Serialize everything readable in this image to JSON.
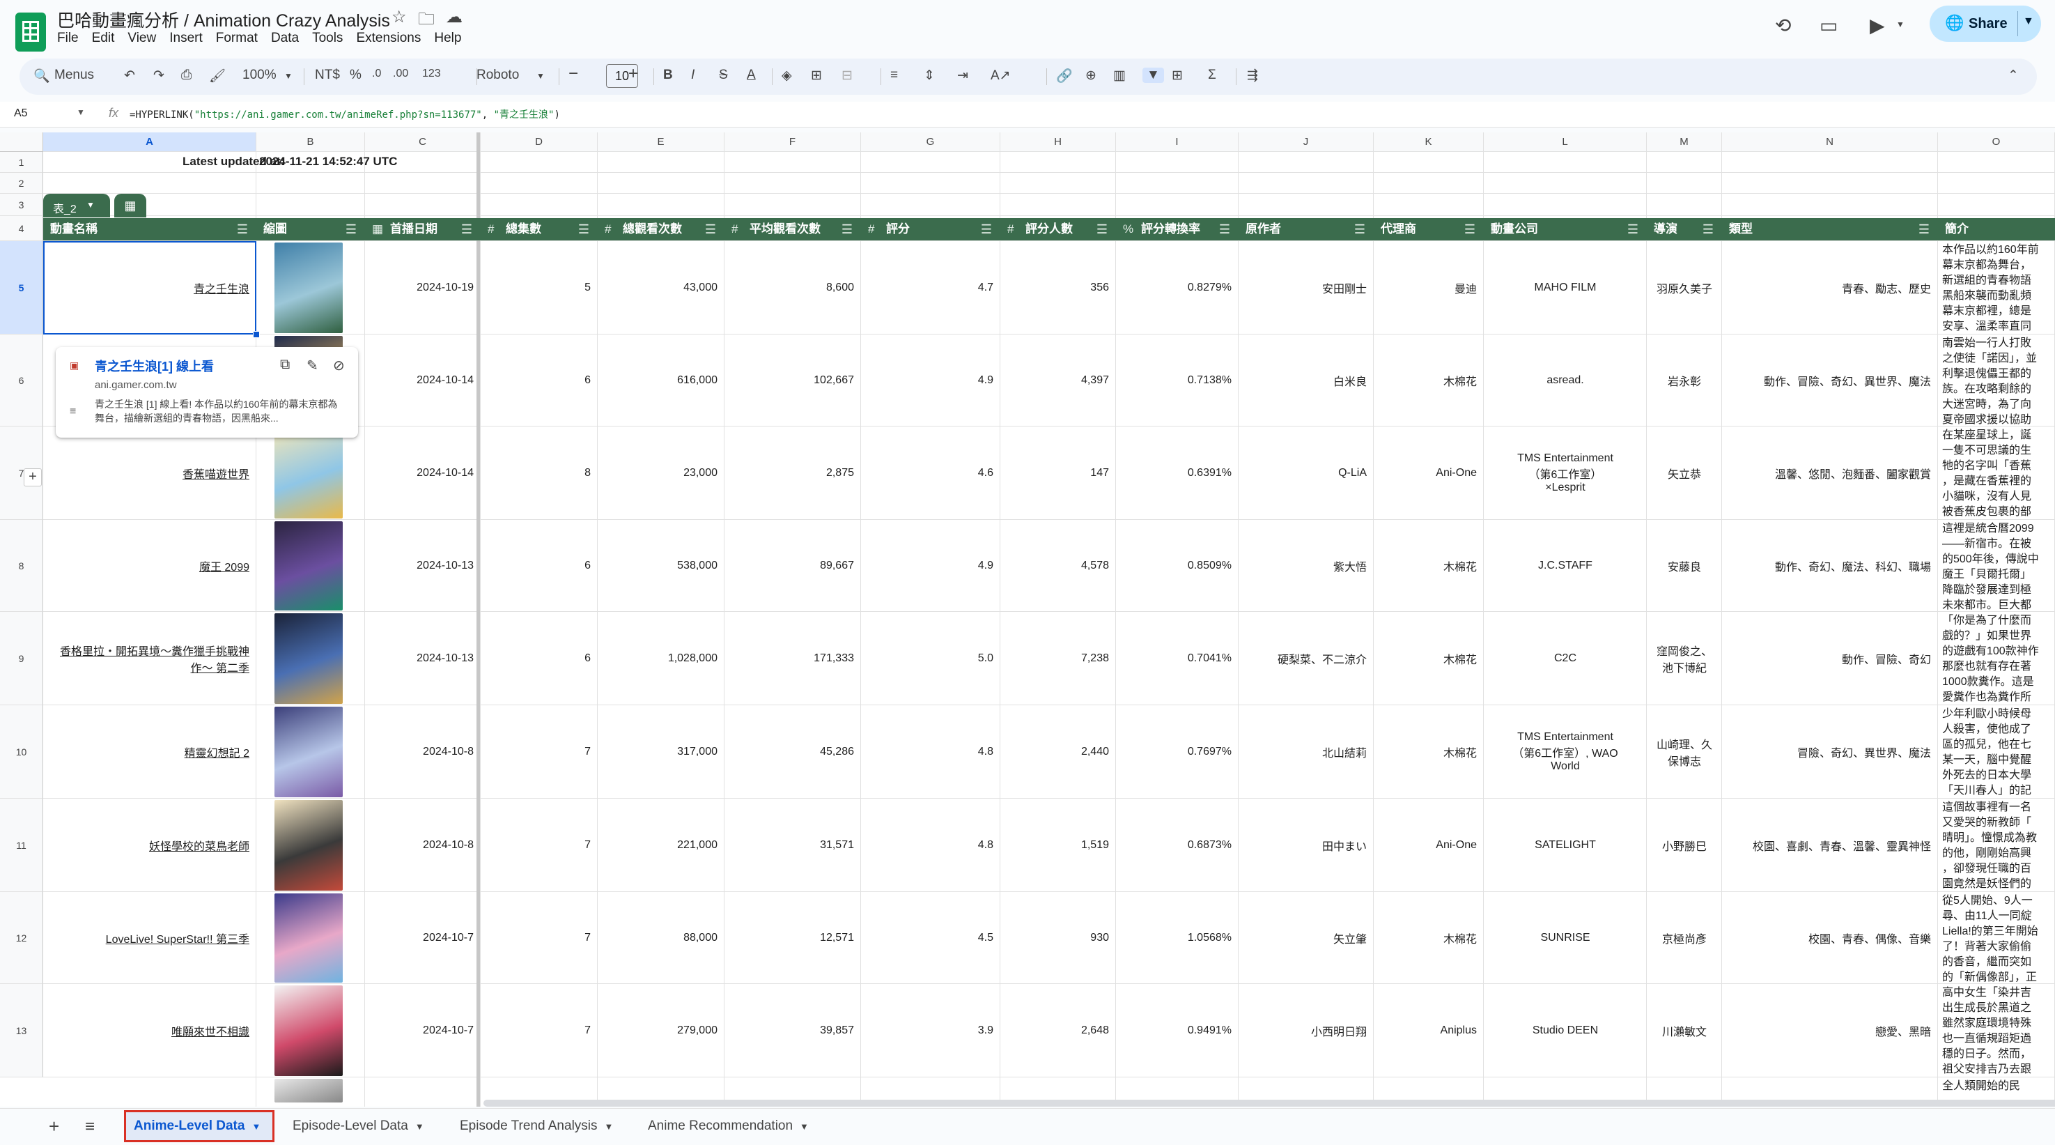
{
  "app": {
    "title": "巴哈動畫瘋分析 / Animation Crazy Analysis",
    "menu": [
      "File",
      "Edit",
      "View",
      "Insert",
      "Format",
      "Data",
      "Tools",
      "Extensions",
      "Help"
    ],
    "share_label": "Share"
  },
  "toolbar": {
    "menus_label": "Menus",
    "zoom": "100%",
    "currency": "NT$",
    "percent": "%",
    "decimals_inc": ".0",
    "decimals_dec": ".00",
    "number_format": "123",
    "font": "Roboto",
    "font_size": "10"
  },
  "formula_bar": {
    "name_box": "A5",
    "formula_prefix": "=HYPERLINK(",
    "formula_url": "\"https://ani.gamer.com.tw/animeRef.php?sn=113677\"",
    "formula_sep": ", ",
    "formula_label": "\"青之壬生浪\"",
    "formula_suffix": ")"
  },
  "columns": [
    "A",
    "B",
    "C",
    "D",
    "E",
    "F",
    "G",
    "H",
    "I",
    "J",
    "K",
    "L",
    "M",
    "N",
    "O"
  ],
  "rows": [
    "1",
    "2",
    "3",
    "4",
    "5",
    "6",
    "7",
    "8",
    "9",
    "10",
    "11",
    "12",
    "13"
  ],
  "updated": {
    "label": "Latest updated at:",
    "value": "2024-11-21 14:52:47 UTC"
  },
  "table": {
    "name": "表_2",
    "headers": [
      {
        "type": "",
        "label": "動畫名稱"
      },
      {
        "type": "",
        "label": "縮圖"
      },
      {
        "type": "▦",
        "label": "首播日期"
      },
      {
        "type": "#",
        "label": "總集數"
      },
      {
        "type": "#",
        "label": "總觀看次數"
      },
      {
        "type": "#",
        "label": "平均觀看次數"
      },
      {
        "type": "#",
        "label": "評分"
      },
      {
        "type": "#",
        "label": "評分人數"
      },
      {
        "type": "%",
        "label": "評分轉換率"
      },
      {
        "type": "",
        "label": "原作者"
      },
      {
        "type": "",
        "label": "代理商"
      },
      {
        "type": "",
        "label": "動畫公司"
      },
      {
        "type": "",
        "label": "導演"
      },
      {
        "type": "",
        "label": "類型"
      },
      {
        "type": "",
        "label": "簡介"
      }
    ],
    "rows": [
      {
        "name": "青之壬生浪",
        "date": "2024-10-19",
        "eps": "5",
        "views": "43,000",
        "avg": "8,600",
        "score": "4.7",
        "raters": "356",
        "rate": "0.8279%",
        "author": "安田剛士",
        "agent": "曼迪",
        "studio": "MAHO FILM",
        "director": "羽原久美子",
        "genre": "青春、勵志、歷史",
        "intro": "本作品以約160年前\n幕末京都為舞台，\n新選組的青春物語\n黑船來襲而動亂頻\n幕末京都裡，總是\n安享、溫柔率直同",
        "thumb": [
          "#3f7fa8",
          "#9cc7d8",
          "#2f5f3f"
        ]
      },
      {
        "name": "",
        "date": "2024-10-14",
        "eps": "6",
        "views": "616,000",
        "avg": "102,667",
        "score": "4.9",
        "raters": "4,397",
        "rate": "0.7138%",
        "author": "白米良",
        "agent": "木棉花",
        "studio": "asread.",
        "director": "岩永彰",
        "genre": "動作、冒險、奇幻、異世界、魔法",
        "intro": "南雲始一行人打敗\n之使徒「諾因」，並\n利擊退傀儡王都的\n族。在攻略剩餘的\n大迷宮時，為了向\n夏帝國求援以協助",
        "thumb": [
          "#1d2a4d",
          "#c9a15b",
          "#5b3a6b"
        ]
      },
      {
        "name": "香蕉喵遊世界",
        "date": "2024-10-14",
        "eps": "8",
        "views": "23,000",
        "avg": "2,875",
        "score": "4.6",
        "raters": "147",
        "rate": "0.6391%",
        "author": "Q-LiA",
        "agent": "Ani-One",
        "studio": "TMS Entertainment\n（第6工作室）\n×Lesprit",
        "director": "矢立恭",
        "genre": "溫馨、悠閒、泡麵番、闔家觀賞",
        "intro": "在某座星球上，誕\n一隻不可思議的生\n牠的名字叫「香蕉\n，是藏在香蕉裡的\n小貓咪，沒有人見\n被香蕉皮包裹的部",
        "thumb": [
          "#f2e6b8",
          "#8fc6e6",
          "#e9b949"
        ]
      },
      {
        "name": "魔王 2099",
        "date": "2024-10-13",
        "eps": "6",
        "views": "538,000",
        "avg": "89,667",
        "score": "4.9",
        "raters": "4,578",
        "rate": "0.8509%",
        "author": "紫大悟",
        "agent": "木棉花",
        "studio": "J.C.STAFF",
        "director": "安藤良",
        "genre": "動作、奇幻、魔法、科幻、職場",
        "intro": "這裡是統合曆2099\n——新宿市。在被\n的500年後，傳說中\n魔王「貝爾托爾」\n降臨於發展達到極\n未來都市。巨大都",
        "thumb": [
          "#2b2440",
          "#6b4fa0",
          "#1a8f6a"
        ]
      },
      {
        "name": "香格里拉・開拓異境～糞作獵手挑戰神作～ 第二季",
        "date": "2024-10-13",
        "eps": "6",
        "views": "1,028,000",
        "avg": "171,333",
        "score": "5.0",
        "raters": "7,238",
        "rate": "0.7041%",
        "author": "硬梨菜、不二涼介",
        "agent": "木棉花",
        "studio": "C2C",
        "director": "窪岡俊之、池下博紀",
        "genre": "動作、冒險、奇幻",
        "intro": "「你是為了什麼而\n戲的？」如果世界\n的遊戲有100款神作\n那麼也就有存在著\n1000款糞作。這是\n愛糞作也為糞作所",
        "thumb": [
          "#1a2238",
          "#4a6fb3",
          "#d1a34a"
        ]
      },
      {
        "name": "精靈幻想記 2",
        "date": "2024-10-8",
        "eps": "7",
        "views": "317,000",
        "avg": "45,286",
        "score": "4.8",
        "raters": "2,440",
        "rate": "0.7697%",
        "author": "北山結莉",
        "agent": "木棉花",
        "studio": "TMS Entertainment\n（第6工作室）, WAO\nWorld",
        "director": "山崎理、久保博志",
        "genre": "冒險、奇幻、異世界、魔法",
        "intro": "少年利歐小時候母\n人殺害，使他成了\n區的孤兒，他在七\n某一天，腦中覺醒\n外死去的日本大學\n「天川春人」的記",
        "thumb": [
          "#3b3f7a",
          "#b7c6e8",
          "#7a5aa6"
        ]
      },
      {
        "name": "妖怪學校的菜鳥老師",
        "date": "2024-10-8",
        "eps": "7",
        "views": "221,000",
        "avg": "31,571",
        "score": "4.8",
        "raters": "1,519",
        "rate": "0.6873%",
        "author": "田中まい",
        "agent": "Ani-One",
        "studio": "SATELIGHT",
        "director": "小野勝巳",
        "genre": "校園、喜劇、青春、溫馨、靈異神怪",
        "intro": "這個故事裡有一名\n又愛哭的新教師「\n晴明」。憧憬成為教\n的他，剛剛始高興\n，卻發現任職的百\n園竟然是妖怪們的",
        "thumb": [
          "#f0e2c0",
          "#3a3a3a",
          "#c44a3a"
        ]
      },
      {
        "name": "LoveLive! SuperStar!! 第三季",
        "date": "2024-10-7",
        "eps": "7",
        "views": "88,000",
        "avg": "12,571",
        "score": "4.5",
        "raters": "930",
        "rate": "1.0568%",
        "author": "矢立肇",
        "agent": "木棉花",
        "studio": "SUNRISE",
        "director": "京極尚彥",
        "genre": "校園、青春、偶像、音樂",
        "intro": "從5人開始、9人一\n尋、由11人一同綻\nLiella!的第三年開始\n了！背著大家偷偷\n的香音，繼而突如\n的「新偶像部」，正",
        "thumb": [
          "#3a3a8a",
          "#e8a8c8",
          "#6fb3e0"
        ]
      },
      {
        "name": "唯願來世不相識",
        "date": "2024-10-7",
        "eps": "7",
        "views": "279,000",
        "avg": "39,857",
        "score": "3.9",
        "raters": "2,648",
        "rate": "0.9491%",
        "author": "小西明日翔",
        "agent": "Aniplus",
        "studio": "Studio DEEN",
        "director": "川瀨敏文",
        "genre": "戀愛、黑暗",
        "intro": "高中女生「染井吉\n出生成長於黑道之\n雖然家庭環境特殊\n也一直循規蹈矩過\n穩的日子。然而，\n祖父安排吉乃去跟",
        "thumb": [
          "#f3f3f3",
          "#d04a6a",
          "#1a1a1a"
        ]
      }
    ],
    "partial_intro": "全人類開始的民"
  },
  "link_preview": {
    "title": "青之壬生浪[1] 線上看",
    "host": "ani.gamer.com.tw",
    "desc": "青之壬生浪 [1] 線上看! 本作品以約160年前的幕末京都為舞台，描繪新選組的青春物語，因黑船來..."
  },
  "sheets": [
    {
      "label": "Anime-Level Data",
      "active": true
    },
    {
      "label": "Episode-Level Data",
      "active": false
    },
    {
      "label": "Episode Trend Analysis",
      "active": false
    },
    {
      "label": "Anime Recommendation",
      "active": false
    }
  ],
  "colors": {
    "header_green": "#3b6c4d",
    "selection_blue": "#0b57d0",
    "active_tab_border": "#d93025"
  }
}
